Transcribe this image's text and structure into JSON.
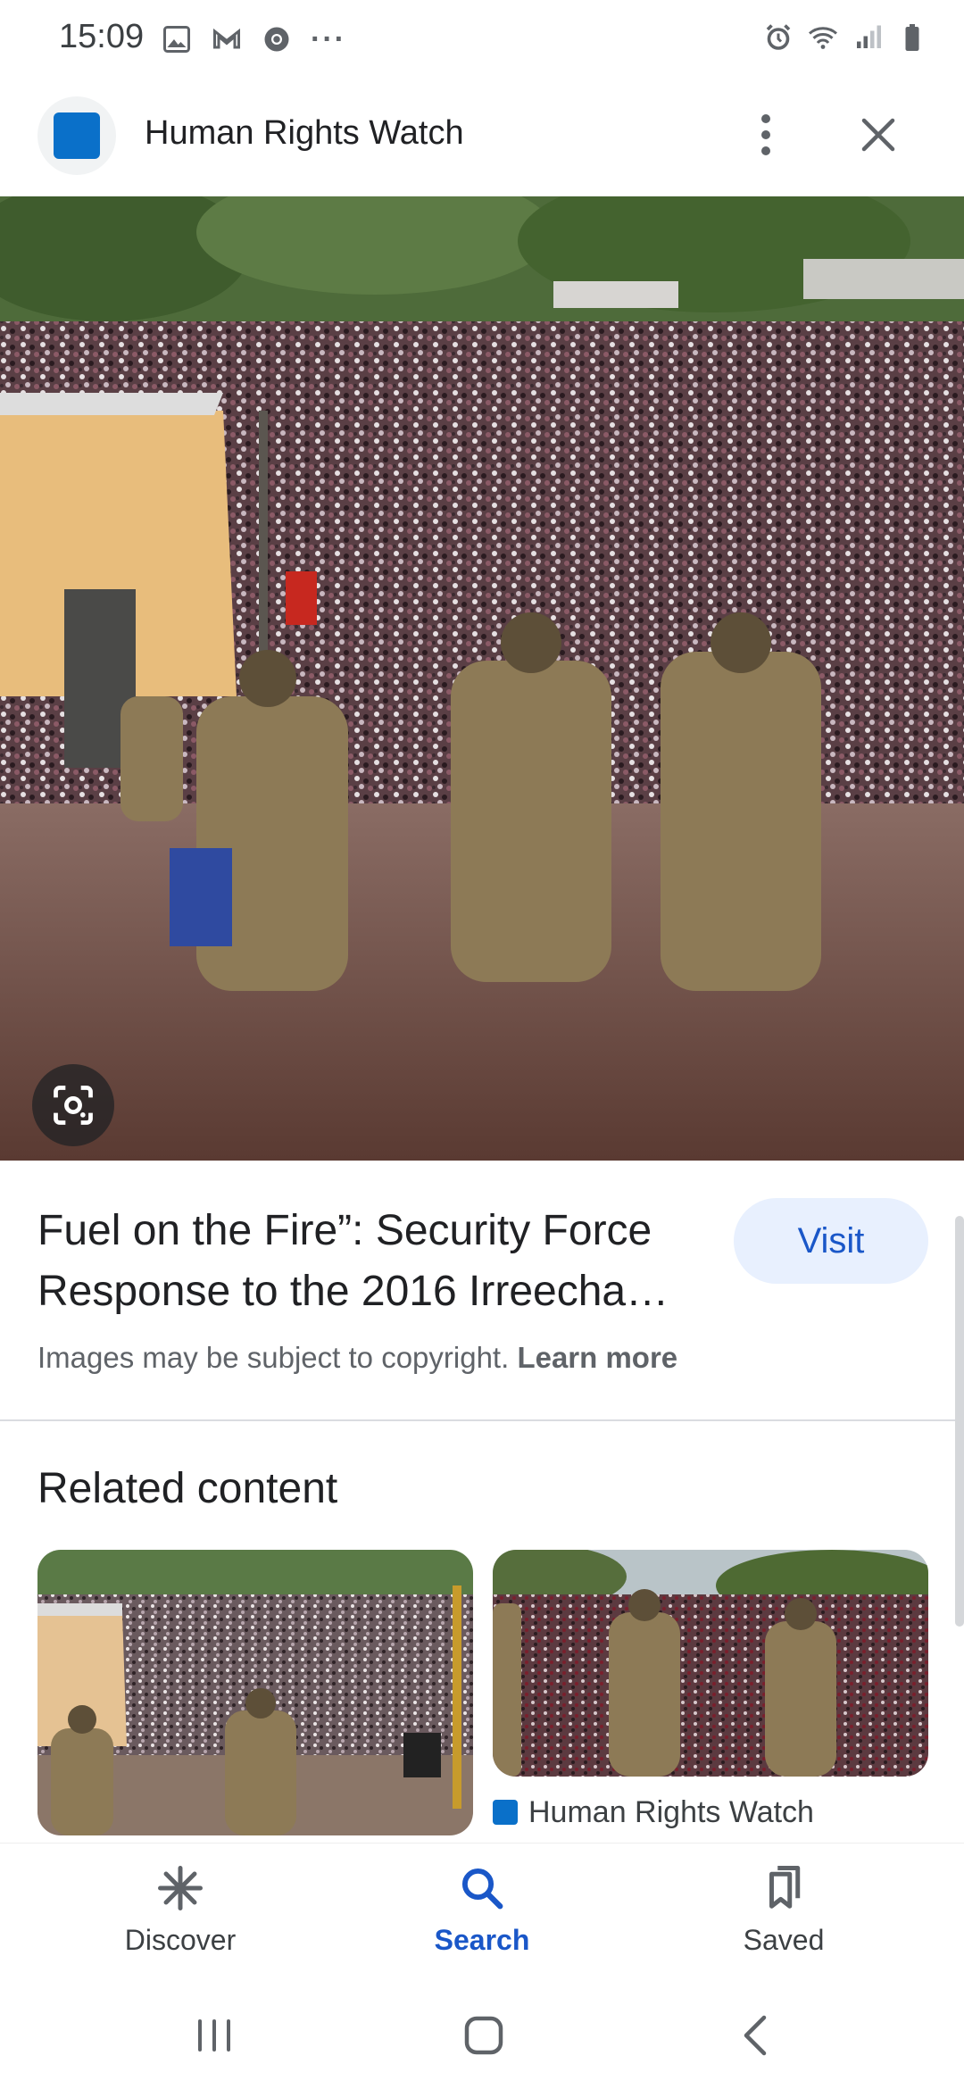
{
  "status_bar": {
    "time": "15:09",
    "overflow": "···"
  },
  "header": {
    "title": "Human Rights Watch",
    "favicon_color": "#0a70c9"
  },
  "hero": {
    "image_icon": "google-lens-icon"
  },
  "result": {
    "title": "Fuel on the Fire”: Security Force Response to the 2016 Irreecha…",
    "visit_label": "Visit",
    "copyright_text": "Images may be subject to copyright. ",
    "learn_more": "Learn more"
  },
  "related": {
    "heading": "Related content",
    "items": [
      {
        "source": ""
      },
      {
        "source": "Human Rights Watch"
      }
    ]
  },
  "bottom_nav": {
    "items": [
      {
        "label": "Discover",
        "icon": "asterisk-icon"
      },
      {
        "label": "Search",
        "icon": "search-icon",
        "active": true
      },
      {
        "label": "Saved",
        "icon": "bookmarks-icon"
      }
    ]
  },
  "colors": {
    "accent": "#1a57c8",
    "visit_bg": "#e8f0fe",
    "favicon": "#0a70c9"
  }
}
